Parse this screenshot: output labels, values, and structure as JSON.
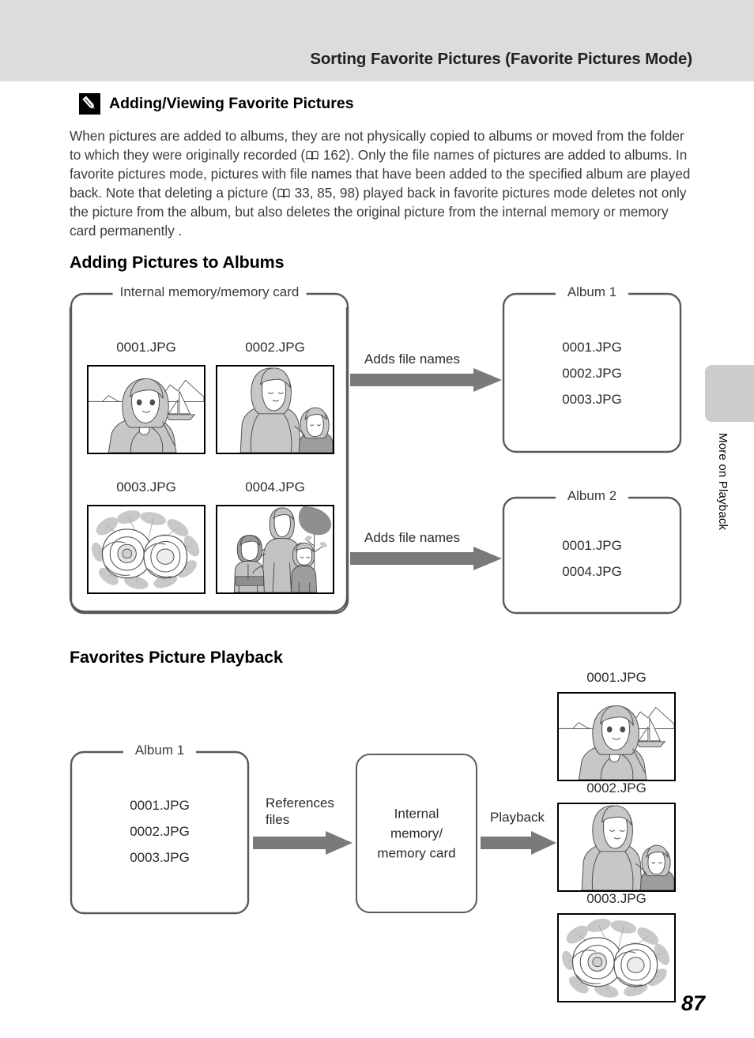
{
  "header": {
    "title": "Sorting Favorite Pictures (Favorite Pictures Mode)"
  },
  "note": {
    "icon": "pencil-icon",
    "title": "Adding/Viewing Favorite Pictures",
    "body": "When pictures are added to albums, they are not physically copied to albums or moved from the folder to which they were originally recorded (□ 162). Only the file names of pictures are added to albums. In favorite pictures mode, pictures with file names that have been added to the specified album are played back. Note that deleting a picture (□ 33, 85, 98) played back in favorite pictures mode deletes not only the picture from the album, but also deletes the original picture from the internal memory or memory card permanently .",
    "body_part1": "When pictures are added to albums, they are not physically copied to albums or moved from the folder to which they were originally recorded (",
    "body_ref1": " 162). Only the file names of pictures are added to albums. In favorite pictures mode, pictures with file names that have been added to the specified album are played back. Note that deleting a picture (",
    "body_ref2": " 33, 85, 98) played back in favorite pictures mode deletes not only the picture from the album, but also deletes the original picture from the internal memory or memory card permanently ."
  },
  "sections": {
    "adding": {
      "heading": "Adding Pictures to Albums",
      "source_box_label": "Internal memory/memory card",
      "thumbnails": [
        {
          "caption": "0001.JPG",
          "art": "beach-portrait"
        },
        {
          "caption": "0002.JPG",
          "art": "mother-child"
        },
        {
          "caption": "0003.JPG",
          "art": "flowers"
        },
        {
          "caption": "0004.JPG",
          "art": "family-walk"
        }
      ],
      "arrows": [
        {
          "label": "Adds file names"
        },
        {
          "label": "Adds file names"
        }
      ],
      "albums": [
        {
          "label": "Album 1",
          "files": [
            "0001.JPG",
            "0002.JPG",
            "0003.JPG"
          ]
        },
        {
          "label": "Album 2",
          "files": [
            "0001.JPG",
            "0004.JPG"
          ]
        }
      ]
    },
    "playback": {
      "heading": "Favorites Picture Playback",
      "album_box": {
        "label": "Album 1",
        "files": [
          "0001.JPG",
          "0002.JPG",
          "0003.JPG"
        ]
      },
      "arrow1_label_line1": "References",
      "arrow1_label_line2": "files",
      "memory_box_line1": "Internal",
      "memory_box_line2": "memory/",
      "memory_box_line3": "memory card",
      "arrow2_label": "Playback",
      "results": [
        {
          "caption": "0001.JPG",
          "art": "beach-portrait"
        },
        {
          "caption": "0002.JPG",
          "art": "mother-child"
        },
        {
          "caption": "0003.JPG",
          "art": "flowers"
        }
      ]
    }
  },
  "side_tab": {
    "text": "More on Playback"
  },
  "page_number": "87",
  "colors": {
    "header_band": "#dcdcdc",
    "arrow_gray": "#7a7a7a",
    "box_stroke": "#58595b",
    "side_tab": "#cccccc",
    "body_text": "#3b3b3b"
  }
}
